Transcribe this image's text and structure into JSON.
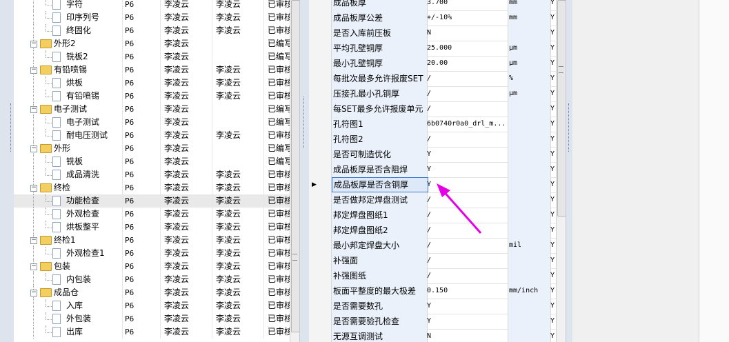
{
  "tree": [
    {
      "name": "字符",
      "type": "doc",
      "level": 1,
      "op": "P6",
      "p1": "李凌云",
      "p2": "李凌云",
      "status": "已审核"
    },
    {
      "name": "印序列号",
      "type": "doc",
      "level": 1,
      "op": "P6",
      "p1": "李凌云",
      "p2": "李凌云",
      "status": "已审核"
    },
    {
      "name": "终固化",
      "type": "doc",
      "level": 1,
      "op": "P6",
      "p1": "李凌云",
      "p2": "李凌云",
      "status": "已审核"
    },
    {
      "name": "外形2",
      "type": "folder",
      "level": 0,
      "op": "P6",
      "p1": "李凌云",
      "p2": "",
      "status": "已编写"
    },
    {
      "name": "铣板2",
      "type": "doc",
      "level": 1,
      "op": "P6",
      "p1": "李凌云",
      "p2": "",
      "status": "已编写"
    },
    {
      "name": "有铅喷锡",
      "type": "folder",
      "level": 0,
      "op": "P6",
      "p1": "李凌云",
      "p2": "李凌云",
      "status": "已审核"
    },
    {
      "name": "烘板",
      "type": "doc",
      "level": 1,
      "op": "P6",
      "p1": "李凌云",
      "p2": "李凌云",
      "status": "已审核"
    },
    {
      "name": "有铅喷锡",
      "type": "doc",
      "level": 1,
      "op": "P6",
      "p1": "李凌云",
      "p2": "李凌云",
      "status": "已审核"
    },
    {
      "name": "电子测试",
      "type": "folder",
      "level": 0,
      "op": "P6",
      "p1": "李凌云",
      "p2": "",
      "status": "已编写"
    },
    {
      "name": "电子测试",
      "type": "doc",
      "level": 1,
      "op": "P6",
      "p1": "李凌云",
      "p2": "",
      "status": "已编写"
    },
    {
      "name": "耐电压测试",
      "type": "doc",
      "level": 1,
      "op": "P6",
      "p1": "李凌云",
      "p2": "李凌云",
      "status": "已审核"
    },
    {
      "name": "外形",
      "type": "folder",
      "level": 0,
      "op": "P6",
      "p1": "李凌云",
      "p2": "",
      "status": "已编写"
    },
    {
      "name": "铣板",
      "type": "doc",
      "level": 1,
      "op": "P6",
      "p1": "李凌云",
      "p2": "",
      "status": "已编写"
    },
    {
      "name": "成品清洗",
      "type": "doc",
      "level": 1,
      "op": "P6",
      "p1": "李凌云",
      "p2": "李凌云",
      "status": "已审核"
    },
    {
      "name": "终检",
      "type": "folder",
      "level": 0,
      "op": "P6",
      "p1": "李凌云",
      "p2": "李凌云",
      "status": "已审核"
    },
    {
      "name": "功能检查",
      "type": "doc",
      "level": 1,
      "op": "P6",
      "p1": "李凌云",
      "p2": "李凌云",
      "status": "已审核",
      "selected": true
    },
    {
      "name": "外观检查",
      "type": "doc",
      "level": 1,
      "op": "P6",
      "p1": "李凌云",
      "p2": "李凌云",
      "status": "已审核"
    },
    {
      "name": "烘板整平",
      "type": "doc",
      "level": 1,
      "op": "P6",
      "p1": "李凌云",
      "p2": "李凌云",
      "status": "已审核"
    },
    {
      "name": "终检1",
      "type": "folder",
      "level": 0,
      "op": "P6",
      "p1": "李凌云",
      "p2": "李凌云",
      "status": "已审核"
    },
    {
      "name": "外观检查1",
      "type": "doc",
      "level": 1,
      "op": "P6",
      "p1": "李凌云",
      "p2": "李凌云",
      "status": "已审核"
    },
    {
      "name": "包装",
      "type": "folder",
      "level": 0,
      "op": "P6",
      "p1": "李凌云",
      "p2": "李凌云",
      "status": "已审核"
    },
    {
      "name": "内包装",
      "type": "doc",
      "level": 1,
      "op": "P6",
      "p1": "李凌云",
      "p2": "李凌云",
      "status": "已审核"
    },
    {
      "name": "成品仓",
      "type": "folder",
      "level": 0,
      "op": "P6",
      "p1": "李凌云",
      "p2": "李凌云",
      "status": "已审核"
    },
    {
      "name": "入库",
      "type": "doc",
      "level": 1,
      "op": "P6",
      "p1": "李凌云",
      "p2": "李凌云",
      "status": "已审核"
    },
    {
      "name": "外包装",
      "type": "doc",
      "level": 1,
      "op": "P6",
      "p1": "李凌云",
      "p2": "李凌云",
      "status": "已审核"
    },
    {
      "name": "出库",
      "type": "doc",
      "level": 1,
      "op": "P6",
      "p1": "李凌云",
      "p2": "李凌云",
      "status": "已审核"
    }
  ],
  "properties": [
    {
      "name": "成品板厚",
      "value": "3.700",
      "unit": "mm",
      "flag": "Y"
    },
    {
      "name": "成品板厚公差",
      "value": "+/-10%",
      "unit": "mm",
      "flag": "Y"
    },
    {
      "name": "是否入库前压板",
      "value": "N",
      "unit": "",
      "flag": "Y"
    },
    {
      "name": "平均孔壁铜厚",
      "value": "25.000",
      "unit": "μm",
      "flag": "Y"
    },
    {
      "name": "最小孔壁铜厚",
      "value": "20.00",
      "unit": "μm",
      "flag": "Y"
    },
    {
      "name": "每批次最多允许报废SET",
      "value": "/",
      "unit": "%",
      "flag": "Y"
    },
    {
      "name": "压接孔最小孔铜厚",
      "value": "/",
      "unit": "μm",
      "flag": "Y"
    },
    {
      "name": "每SET最多允许报废单元",
      "value": "/",
      "unit": "",
      "flag": "Y"
    },
    {
      "name": "孔符图1",
      "value": "6b0740r0a0_drl_m...",
      "unit": "",
      "flag": "Y"
    },
    {
      "name": "孔符图2",
      "value": "/",
      "unit": "",
      "flag": "Y"
    },
    {
      "name": "是否可制造优化",
      "value": "Y",
      "unit": "",
      "flag": "Y"
    },
    {
      "name": "成品板厚是否含阻焊",
      "value": "Y",
      "unit": "",
      "flag": "Y"
    },
    {
      "name": "成品板厚是否含铜厚",
      "value": "Y",
      "unit": "",
      "flag": "Y",
      "current": true
    },
    {
      "name": "是否做邦定焊盘测试",
      "value": "/",
      "unit": "",
      "flag": "Y"
    },
    {
      "name": "邦定焊盘图纸1",
      "value": "/",
      "unit": "",
      "flag": "Y"
    },
    {
      "name": "邦定焊盘图纸2",
      "value": "/",
      "unit": "",
      "flag": "Y"
    },
    {
      "name": "最小邦定焊盘大小",
      "value": "/",
      "unit": "mil",
      "flag": "Y"
    },
    {
      "name": "补强面",
      "value": "/",
      "unit": "",
      "flag": "Y"
    },
    {
      "name": "补强图纸",
      "value": "/",
      "unit": "",
      "flag": "Y"
    },
    {
      "name": "板面平整度的最大极差",
      "value": "0.150",
      "unit": "mm/inch",
      "flag": "Y"
    },
    {
      "name": "是否需要数孔",
      "value": "Y",
      "unit": "",
      "flag": "Y"
    },
    {
      "name": "是否需要验孔检查",
      "value": "Y",
      "unit": "",
      "flag": "Y"
    },
    {
      "name": "无源互调测试",
      "value": "N",
      "unit": "",
      "flag": "Y"
    }
  ],
  "icons": {
    "folder": "folder-icon",
    "doc": "document-icon",
    "expander": "tree-collapse-icon",
    "row_pointer": "row-pointer-icon"
  },
  "annotation_color": "#e600e6"
}
